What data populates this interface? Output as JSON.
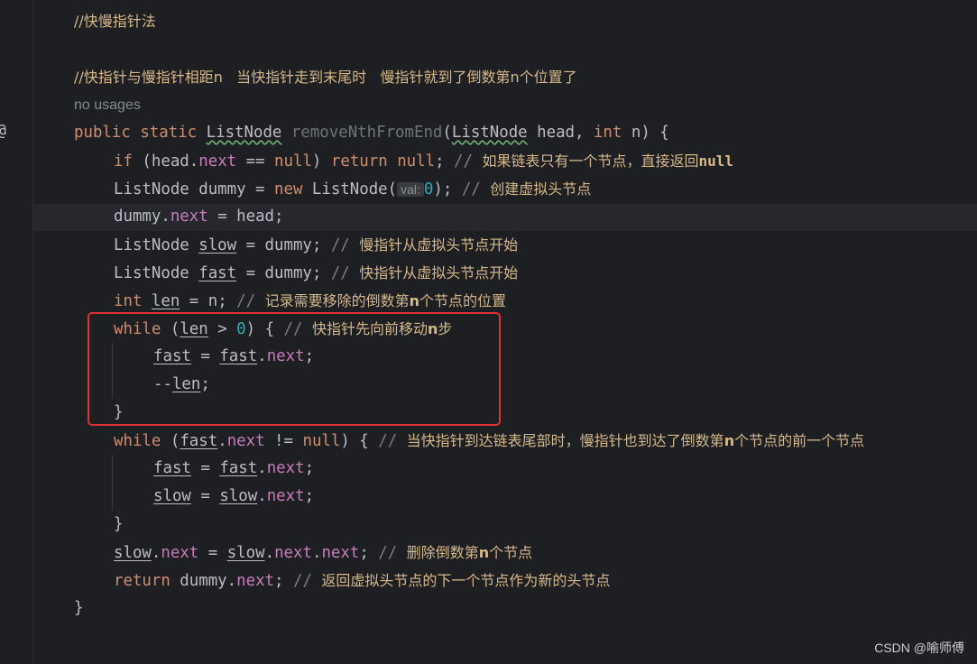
{
  "gutter": {
    "annotation_glyph": "@"
  },
  "code": {
    "lines": [
      [
        "//快慢指针法"
      ],
      [
        ""
      ],
      [
        "//快指针与慢指针相距n   当快指针走到末尾时   慢指针就到了倒数第n个位置了"
      ],
      [
        "no usages"
      ],
      [
        "public",
        " ",
        "static",
        " ",
        "ListNode",
        " ",
        "removeNthFromEnd",
        "(",
        "ListNode",
        " head, ",
        "int",
        " n) {"
      ],
      [
        "if",
        " (head.",
        "next",
        " == ",
        "null",
        ") ",
        "return",
        " ",
        "null",
        "; ",
        "// ",
        "如果链表只有一个节点，直接返回",
        "null"
      ],
      [
        "ListNode dummy = ",
        "new",
        " ListNode(",
        "val:",
        "0",
        "); ",
        "// ",
        "创建虚拟头节点"
      ],
      [
        "dummy.",
        "next",
        " = head;"
      ],
      [
        "ListNode ",
        "slow",
        " = dummy; ",
        "// ",
        "慢指针从虚拟头节点开始"
      ],
      [
        "ListNode ",
        "fast",
        " = dummy; ",
        "// ",
        "快指针从虚拟头节点开始"
      ],
      [
        "int",
        " ",
        "len",
        " = n; ",
        "// ",
        "记录需要移除的倒数第",
        "n",
        "个节点的位置"
      ],
      [
        "while",
        " (",
        "len",
        " > ",
        "0",
        ") { ",
        "// ",
        "快指针先向前移动",
        "n",
        "步"
      ],
      [
        "fast",
        " = ",
        "fast",
        ".",
        "next",
        ";"
      ],
      [
        "--",
        "len",
        ";"
      ],
      [
        "}"
      ],
      [
        "while",
        " (",
        "fast",
        ".",
        "next",
        " != ",
        "null",
        ") { ",
        "// ",
        "当快指针到达链表尾部时，慢指针也到达了倒数第",
        "n",
        "个节点的前一个节点"
      ],
      [
        "fast",
        " = ",
        "fast",
        ".",
        "next",
        ";"
      ],
      [
        "slow",
        " = ",
        "slow",
        ".",
        "next",
        ";"
      ],
      [
        "}"
      ],
      [
        "slow",
        ".",
        "next",
        " = ",
        "slow",
        ".",
        "next",
        ".",
        "next",
        "; ",
        "// ",
        "删除倒数第",
        "n",
        "个节点"
      ],
      [
        "return",
        " dummy.",
        "next",
        "; ",
        "// ",
        "返回虚拟头节点的下一个节点作为新的头节点"
      ],
      [
        "}"
      ]
    ]
  },
  "watermark": "CSDN @喻师傅",
  "colors": {
    "background": "#1e1f22",
    "keyword": "#cf8e6d",
    "field": "#c77dbb",
    "number": "#2aacb8",
    "comment": "#7a7e85",
    "comment_cjk": "#d6b889",
    "highlight_box": "#e03131"
  }
}
